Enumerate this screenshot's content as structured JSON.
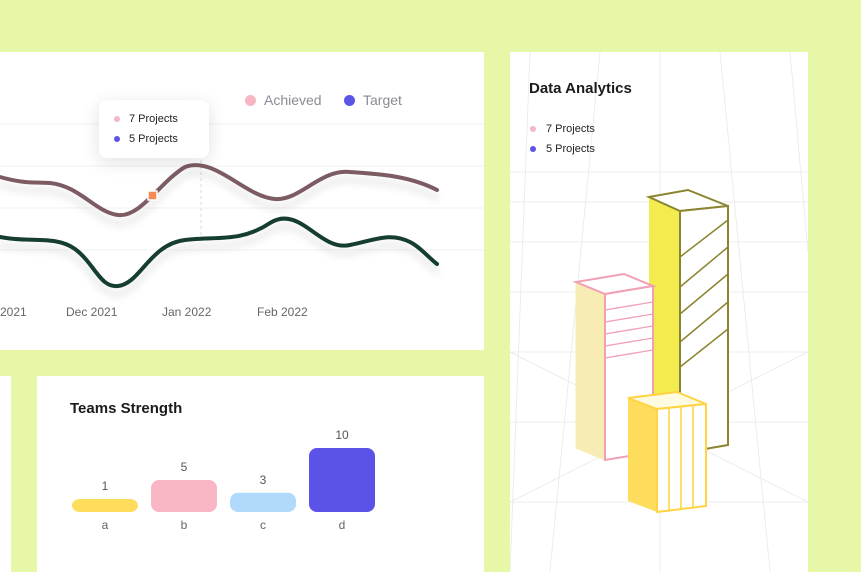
{
  "line_chart": {
    "legend": [
      {
        "label": "Achieved",
        "color": "#f6b6c4"
      },
      {
        "label": "Target",
        "color": "#5a55e6"
      }
    ],
    "tooltip": [
      {
        "label": "7 Projects",
        "color": "#f6b6c4"
      },
      {
        "label": "5 Projects",
        "color": "#5a55e6"
      }
    ],
    "xticks": [
      "2021",
      "Dec 2021",
      "Jan 2022",
      "Feb 2022"
    ],
    "colors": {
      "upper": "#7b5c62",
      "lower": "#173c33",
      "marker": "#f48b55"
    }
  },
  "teams_strength": {
    "title": "Teams Strength",
    "chart_data": {
      "type": "bar",
      "categories": [
        "a",
        "b",
        "c",
        "d"
      ],
      "values": [
        1,
        5,
        3,
        10
      ],
      "value_labels": [
        "1",
        "5",
        "3",
        "10"
      ],
      "colors": [
        "#ffdd5c",
        "#f9b6c4",
        "#b1d9fb",
        "#5b52e8"
      ],
      "ylim": [
        0,
        10
      ]
    }
  },
  "analytics": {
    "title": "Data Analytics",
    "legend": [
      {
        "label": "7 Projects",
        "color": "#f6b6c4"
      },
      {
        "label": "5 Projects",
        "color": "#5a55e6"
      }
    ]
  }
}
